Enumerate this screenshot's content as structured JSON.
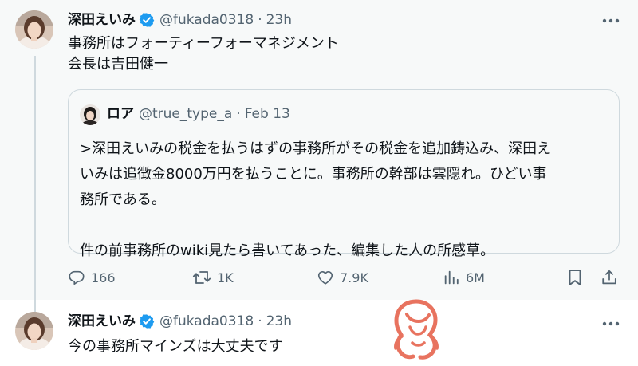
{
  "post1": {
    "display_name": "深田えいみ",
    "handle": "@fukada0318",
    "separator": "·",
    "time": "23h",
    "text_line1": "事務所はフォーティーフォーマネジメント",
    "text_line2": "会長は吉田健一",
    "quote": {
      "display_name": "ロア",
      "handle": "@true_type_a",
      "separator": "·",
      "date": "Feb 13",
      "line1": ">深田えいみの税金を払うはずの事務所がその税金を追加鋳込み、深田え",
      "line2": "いみは追徴金8000万円を払うことに。事務所の幹部は雲隠れ。ひどい事",
      "line3": "務所である。",
      "line4": "件の前事務所のwiki見たら書いてあった、編集した人の所感草。"
    },
    "actions": {
      "replies": "166",
      "reposts": "1K",
      "likes": "7.9K",
      "views": "6M"
    }
  },
  "post2": {
    "display_name": "深田えいみ",
    "handle": "@fukada0318",
    "separator": "·",
    "time": "23h",
    "text": "今の事務所マインズは大丈夫です"
  },
  "colors": {
    "verified": "#1d9bf0",
    "secondary_text": "#536471",
    "thread_line": "#cfd9de",
    "watermark": "#e8735f"
  }
}
